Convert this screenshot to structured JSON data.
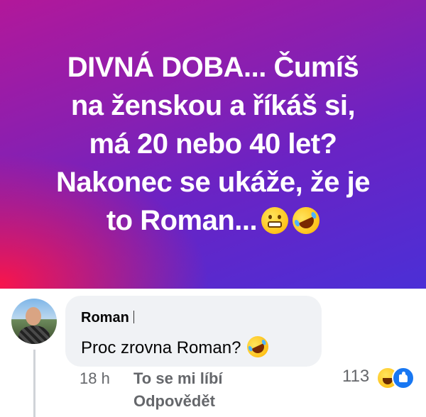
{
  "post": {
    "text_lines": [
      "DIVNÁ DOBA... Čumíš",
      "na ženskou a říkáš si,",
      "má 20 nebo 40 let?",
      "Nakonec se ukáže, že je",
      "to Roman..."
    ],
    "end_emojis": [
      "grimacing-face-emoji",
      "rolling-on-floor-laughing-emoji"
    ],
    "colors": {
      "gradient_start": "#ff1446",
      "gradient_mid": "#8a1fb0",
      "gradient_end": "#4b2fd6"
    }
  },
  "comment": {
    "author": "Roman",
    "text": "Proc zrovna Roman?",
    "text_emoji": "rolling-on-floor-laughing-emoji",
    "time": "18 h",
    "like_label": "To se mi líbí",
    "reply_label": "Odpovědět",
    "reaction_count": "113",
    "reactions": [
      "haha-reaction-icon",
      "like-reaction-icon"
    ]
  }
}
